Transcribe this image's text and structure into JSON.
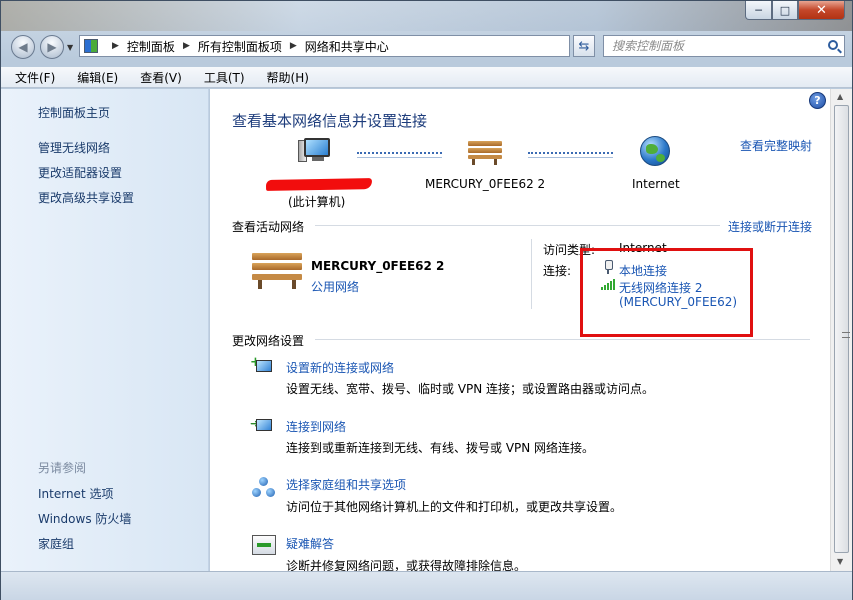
{
  "window": {
    "controls": {
      "minimize": "─",
      "maximize": "□",
      "close": "✕"
    }
  },
  "address": {
    "crumbs": [
      "控制面板",
      "所有控制面板项",
      "网络和共享中心"
    ],
    "search_placeholder": "搜索控制面板"
  },
  "menu": [
    "文件(F)",
    "编辑(E)",
    "查看(V)",
    "工具(T)",
    "帮助(H)"
  ],
  "sidebar": {
    "items": [
      "控制面板主页",
      "管理无线网络",
      "更改适配器设置",
      "更改高级共享设置"
    ],
    "see_also_label": "另请参阅",
    "see_also": [
      "Internet 选项",
      "Windows 防火墙",
      "家庭组"
    ]
  },
  "main": {
    "title": "查看基本网络信息并设置连接",
    "full_map_link": "查看完整映射",
    "map": {
      "computer_sub": "(此计算机)",
      "network_name": "MERCURY_0FEE62  2",
      "internet_label": "Internet"
    },
    "active_section": {
      "heading": "查看活动网络",
      "connect_link": "连接或断开连接",
      "network_name": "MERCURY_0FEE62  2",
      "network_type": "公用网络",
      "access_type_label": "访问类型:",
      "access_type_value": "Internet",
      "connections_label": "连接:",
      "connection_local": "本地连接",
      "connection_wireless": "无线网络连接 2",
      "connection_wireless_ssid": "(MERCURY_0FEE62)"
    },
    "change_section": {
      "heading": "更改网络设置",
      "tasks": [
        {
          "title": "设置新的连接或网络",
          "desc": "设置无线、宽带、拨号、临时或 VPN 连接；或设置路由器或访问点。"
        },
        {
          "title": "连接到网络",
          "desc": "连接到或重新连接到无线、有线、拨号或 VPN 网络连接。"
        },
        {
          "title": "选择家庭组和共享选项",
          "desc": "访问位于其他网络计算机上的文件和打印机，或更改共享设置。"
        },
        {
          "title": "疑难解答",
          "desc": "诊断并修复网络问题，或获得故障排除信息。"
        }
      ]
    },
    "help_glyph": "?"
  },
  "colors": {
    "link": "#1a56b3",
    "title": "#1e3d7c",
    "highlight": "#e01010",
    "redaction": "#f20d0d"
  }
}
